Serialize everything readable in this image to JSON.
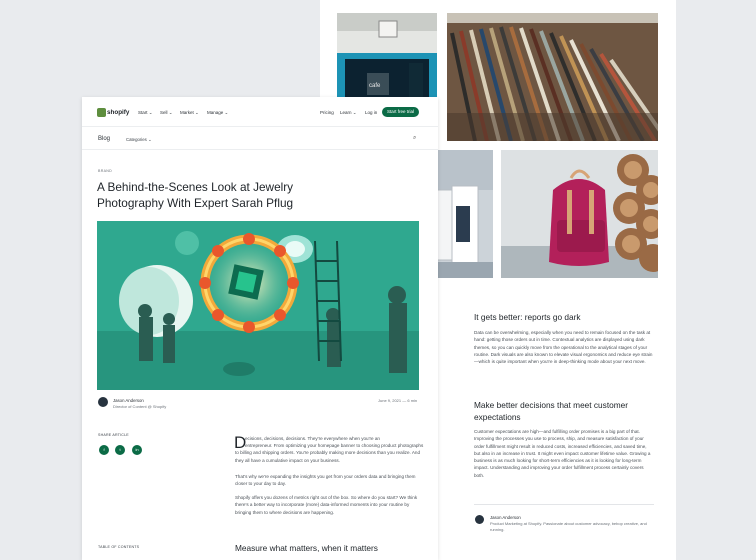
{
  "nav": {
    "brand": "shopify",
    "menu": [
      "Start",
      "Sell",
      "Market",
      "Manage"
    ],
    "right": [
      "Pricing",
      "Learn",
      "Log in"
    ],
    "cta": "Start free trial"
  },
  "blog": {
    "title": "Blog",
    "categories_label": "Categories"
  },
  "article": {
    "badge": "BRAND",
    "title_line1": "A Behind-the-Scenes Look at Jewelry",
    "title_line2": "Photography With Expert Sarah Pflug",
    "author_name": "Jason Anderson",
    "author_role": "Director of Content @ Shopify",
    "date_read": "June 9, 2021 — 6 min",
    "share_label": "SHARE ARTICLE",
    "share_icons": [
      "facebook-icon",
      "twitter-icon",
      "linkedin-icon"
    ],
    "share_glyphs": [
      "f",
      "t",
      "in"
    ],
    "drop_cap": "D",
    "para1_first": "ecisions, decisions, decisions. They're everywhere when you're an",
    "para1_rest": "entrepreneur. From optimizing your homepage banner to choosing product photographs to billing and shipping orders. You're probably making more decisions than you realize. And they all have a cumulative impact on your business.",
    "para2": "That's why we're expanding the insights you get from your orders data and bringing them closer to your day to day.",
    "para3": "Shopify offers you dozens of metrics right out of the box. So where do you start? We think there's a better way to incorporate (more) data-informed moments into your routine by bringing them to where decisions are happening.",
    "toc_label": "TABLE OF CONTENTS",
    "section_heading": "Measure what matters, when it matters"
  },
  "back": {
    "heading1": "It gets better: reports go dark",
    "body1": "Data can be overwhelming, especially when you need to remain focused on the task at hand: getting those orders out in time. Contextual analytics are displayed using dark themes, so you can quickly move from the operational to the analytical stages of your routine. Dark visuals are also known to elevate visual ergonomics and reduce eye strain—which is quite important when you're in deep-thinking mode about your next move.",
    "heading2_line1": "Make better decisions that meet customer",
    "heading2_line2": "expectations",
    "body2": "Customer expectations are high—and fulfilling order promises is a big part of that. Improving the processes you use to process, ship, and measure satisfaction of your order fulfillment might result in reduced costs, increased efficiencies, and saved time, but also in an increase in trust. It might even impact customer lifetime value. Growing a business is as much looking for short-term efficiencies as it is looking for long-term impact. Understanding and improving your order fulfillment process certainly covers both.",
    "author_name": "Jason Anderson",
    "author_bio": "Product Marketing at Shopify. Passionate about customer advocacy, bebop creative, and running."
  },
  "colors": {
    "brand_green": "#0b6b46",
    "hero_teal": "#2fa88f",
    "page_bg": "#e9ebee"
  }
}
